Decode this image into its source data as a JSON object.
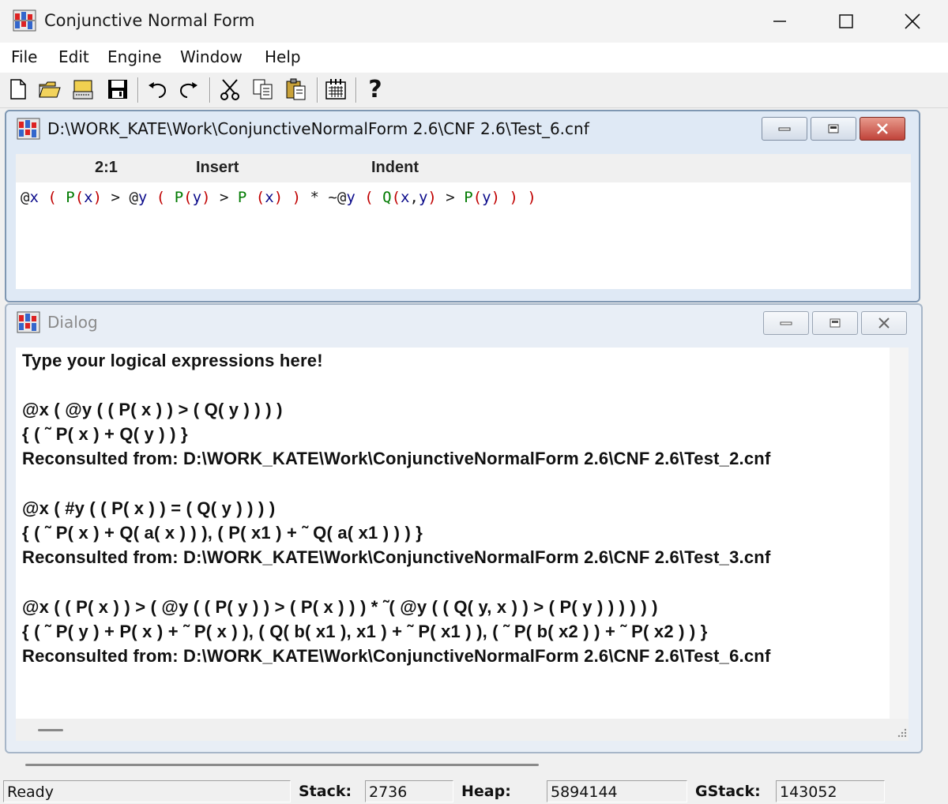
{
  "window": {
    "title": "Conjunctive Normal Form"
  },
  "menu": {
    "items": [
      "File",
      "Edit",
      "Engine",
      "Window",
      "Help"
    ]
  },
  "toolbar": {
    "buttons": [
      "new-file-icon",
      "open-folder-icon",
      "drive-icon",
      "save-icon",
      "undo-icon",
      "redo-icon",
      "cut-icon",
      "copy-icon",
      "paste-icon",
      "calendar-icon",
      "help-icon"
    ],
    "help_glyph": "?"
  },
  "editor": {
    "title": "D:\\WORK_KATE\\Work\\ConjunctiveNormalForm 2.6\\CNF 2.6\\Test_6.cnf",
    "position": "2:1",
    "mode": "Insert",
    "indent": "Indent",
    "line": "@x ( P(x) > @y ( P(y) > P (x) ) * ~@y ( Q(x,y) > P(y) ) )",
    "colors": {
      "operator": "#1a1a1a",
      "paren": "#c00000",
      "predicate": "#007a00",
      "variable": "#0a0a8a"
    }
  },
  "dialog": {
    "title": "Dialog",
    "lines": [
      "Type your logical expressions here!",
      "",
      "@x ( @y ( ( P( x ) ) > ( Q( y ) ) ) )",
      "{ ( ˜ P( x ) + Q( y ) ) }",
      "Reconsulted from: D:\\WORK_KATE\\Work\\ConjunctiveNormalForm 2.6\\CNF 2.6\\Test_2.cnf",
      "",
      "@x ( #y ( ( P( x ) ) = ( Q( y ) ) ) )",
      "{ ( ˜ P( x ) + Q( a( x ) ) ), ( P( x1 ) + ˜ Q( a( x1 ) ) ) }",
      "Reconsulted from: D:\\WORK_KATE\\Work\\ConjunctiveNormalForm 2.6\\CNF 2.6\\Test_3.cnf",
      "",
      "@x ( ( P( x ) ) > ( @y ( ( P( y ) ) > ( P( x ) ) ) * ˜( @y ( ( Q( y, x ) ) > ( P( y ) ) ) ) ) )",
      "{ ( ˜ P( y ) + P( x ) + ˜ P( x ) ), ( Q( b( x1 ), x1 ) + ˜ P( x1 ) ), ( ˜ P( b( x2 ) ) + ˜ P( x2 ) ) }",
      "Reconsulted from: D:\\WORK_KATE\\Work\\ConjunctiveNormalForm 2.6\\CNF 2.6\\Test_6.cnf"
    ]
  },
  "status": {
    "ready": "Ready",
    "stack_label": "Stack:",
    "stack_value": "2736",
    "heap_label": "Heap:",
    "heap_value": "5894144",
    "gstack_label": "GStack:",
    "gstack_value": "143052"
  }
}
